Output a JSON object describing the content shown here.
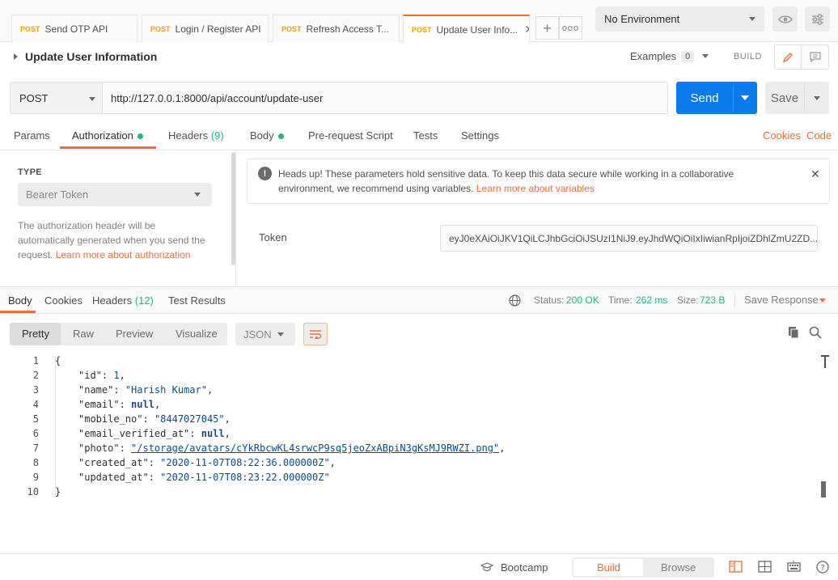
{
  "tabs": [
    {
      "method": "POST",
      "label": "Send OTP API"
    },
    {
      "method": "POST",
      "label": "Login / Register API"
    },
    {
      "method": "POST",
      "label": "Refresh Access T..."
    },
    {
      "method": "POST",
      "label": "Update User Info..."
    }
  ],
  "environment": {
    "selected": "No Environment"
  },
  "request": {
    "name": "Update User Information",
    "examples_label": "Examples",
    "examples_count": "0",
    "build_label": "BUILD",
    "method": "POST",
    "url": "http://127.0.0.1:8000/api/account/update-user",
    "send_label": "Send",
    "save_label": "Save"
  },
  "request_tabs": {
    "params": "Params",
    "authorization": "Authorization",
    "headers": "Headers",
    "headers_count": "(9)",
    "body": "Body",
    "prerequest": "Pre-request Script",
    "tests": "Tests",
    "settings": "Settings",
    "cookies": "Cookies",
    "code": "Code"
  },
  "auth": {
    "type_label": "TYPE",
    "type_value": "Bearer Token",
    "help_text": "The authorization header will be automatically generated when you send the request.",
    "help_link": "Learn more about authorization",
    "warning_text": "Heads up! These parameters hold sensitive data. To keep this data secure while working in a collaborative environment, we recommend using variables.",
    "warning_link": "Learn more about variables",
    "token_label": "Token",
    "token_value": "eyJ0eXAiOiJKV1QiLCJhbGciOiJSUzI1NiJ9.eyJhdWQiOiIxIiwianRpIjoiZDhlZmU2ZD..."
  },
  "response_tabs": {
    "body": "Body",
    "cookies": "Cookies",
    "headers": "Headers",
    "headers_count": "(12)",
    "test_results": "Test Results"
  },
  "response_meta": {
    "status_label": "Status:",
    "status_value": "200 OK",
    "time_label": "Time:",
    "time_value": "262 ms",
    "size_label": "Size:",
    "size_value": "723 B",
    "save_response": "Save Response"
  },
  "view": {
    "pretty": "Pretty",
    "raw": "Raw",
    "preview": "Preview",
    "visualize": "Visualize",
    "format": "JSON"
  },
  "code_lines": [
    {
      "n": "1"
    },
    {
      "n": "2"
    },
    {
      "n": "3"
    },
    {
      "n": "4"
    },
    {
      "n": "5"
    },
    {
      "n": "6"
    },
    {
      "n": "7"
    },
    {
      "n": "8"
    },
    {
      "n": "9"
    },
    {
      "n": "10"
    }
  ],
  "response_body": {
    "open": "{",
    "close": "}",
    "id_key": "\"id\"",
    "id_val": "1",
    "name_key": "\"name\"",
    "name_val": "\"Harish Kumar\"",
    "email_key": "\"email\"",
    "email_val": "null",
    "mobile_key": "\"mobile_no\"",
    "mobile_val": "\"8447027045\"",
    "verified_key": "\"email_verified_at\"",
    "verified_val": "null",
    "photo_key": "\"photo\"",
    "photo_val": "\"/storage/avatars/cYkRbcwKL4srwcP9sq5jeoZxABpiN3gKsMJ9RWZI.png\"",
    "created_key": "\"created_at\"",
    "created_val": "\"2020-11-07T08:22:36.000000Z\"",
    "updated_key": "\"updated_at\"",
    "updated_val": "\"2020-11-07T08:23:22.000000Z\""
  },
  "status_bar": {
    "bootcamp": "Bootcamp",
    "build": "Build",
    "browse": "Browse"
  },
  "colors": {
    "accent": "#f26b3a",
    "send": "#097bed",
    "success": "#26b47f",
    "method_post": "#e8a400"
  }
}
